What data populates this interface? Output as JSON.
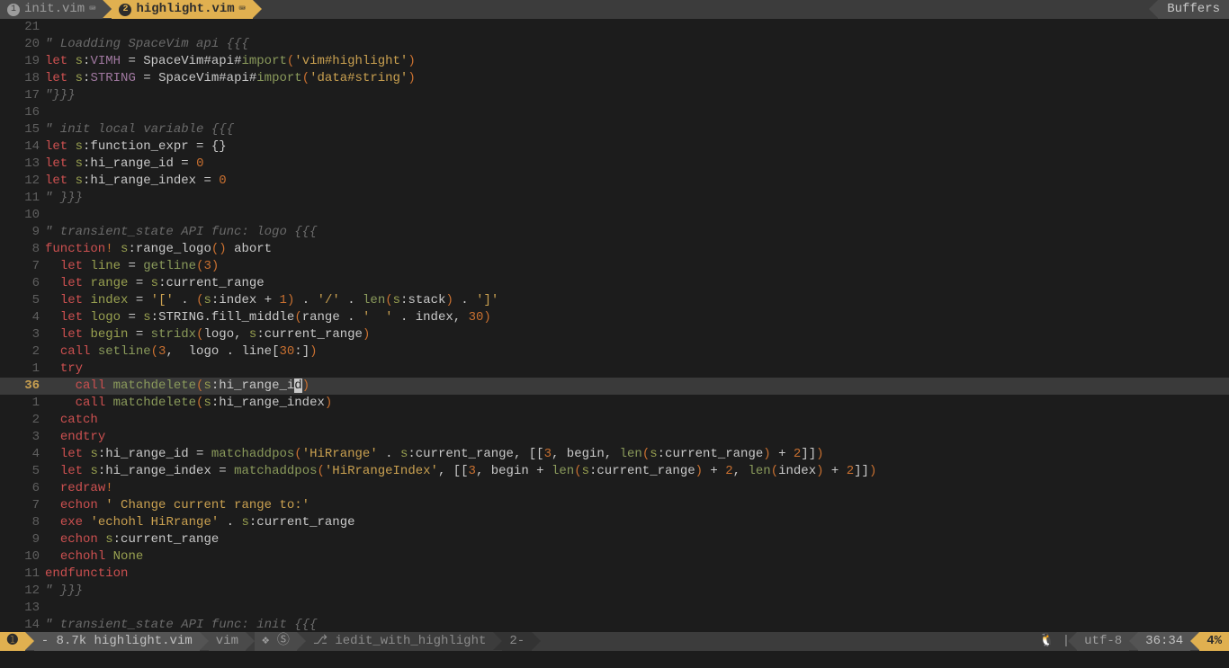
{
  "tabs": {
    "inactive": {
      "num": "1",
      "name": "init.vim"
    },
    "active": {
      "num": "2",
      "name": "highlight.vim"
    },
    "right_label": "Buffers"
  },
  "lines": [
    {
      "n": "21",
      "seg": []
    },
    {
      "n": "20",
      "seg": [
        [
          "\" Loadding SpaceVim api {{{",
          "k-comment"
        ]
      ]
    },
    {
      "n": "19",
      "seg": [
        [
          "let",
          "k-red"
        ],
        [
          " s",
          "k-olive"
        ],
        [
          ":",
          ""
        ],
        [
          "VIMH",
          "k-purple"
        ],
        [
          " = SpaceVim#api#",
          ""
        ],
        [
          "import",
          "k-green"
        ],
        [
          "(",
          "k-orange"
        ],
        [
          "'vim#highlight'",
          "k-yellow"
        ],
        [
          ")",
          "k-orange"
        ]
      ]
    },
    {
      "n": "18",
      "seg": [
        [
          "let",
          "k-red"
        ],
        [
          " s",
          "k-olive"
        ],
        [
          ":",
          ""
        ],
        [
          "STRING",
          "k-purple"
        ],
        [
          " = SpaceVim#api#",
          ""
        ],
        [
          "import",
          "k-green"
        ],
        [
          "(",
          "k-orange"
        ],
        [
          "'data#string'",
          "k-yellow"
        ],
        [
          ")",
          "k-orange"
        ]
      ]
    },
    {
      "n": "17",
      "seg": [
        [
          "\"}}}",
          "k-comment"
        ]
      ]
    },
    {
      "n": "16",
      "seg": []
    },
    {
      "n": "15",
      "seg": [
        [
          "\" init local variable {{{",
          "k-comment"
        ]
      ]
    },
    {
      "n": "14",
      "seg": [
        [
          "let",
          "k-red"
        ],
        [
          " s",
          "k-olive"
        ],
        [
          ":function_expr = {}",
          ""
        ]
      ]
    },
    {
      "n": "13",
      "seg": [
        [
          "let",
          "k-red"
        ],
        [
          " s",
          "k-olive"
        ],
        [
          ":hi_range_id = ",
          ""
        ],
        [
          "0",
          "k-orange"
        ]
      ]
    },
    {
      "n": "12",
      "seg": [
        [
          "let",
          "k-red"
        ],
        [
          " s",
          "k-olive"
        ],
        [
          ":hi_range_index = ",
          ""
        ],
        [
          "0",
          "k-orange"
        ]
      ]
    },
    {
      "n": "11",
      "seg": [
        [
          "\" }}}",
          "k-comment"
        ]
      ]
    },
    {
      "n": "10",
      "seg": []
    },
    {
      "n": "9",
      "seg": [
        [
          "\" transient_state API func: logo {{{",
          "k-comment"
        ]
      ]
    },
    {
      "n": "8",
      "seg": [
        [
          "function",
          "k-red"
        ],
        [
          "!",
          "k-orange"
        ],
        [
          " ",
          ""
        ],
        [
          "s",
          "k-olive"
        ],
        [
          ":range_logo",
          ""
        ],
        [
          "()",
          "k-orange"
        ],
        [
          " abort",
          ""
        ]
      ]
    },
    {
      "n": "7",
      "seg": [
        [
          "  ",
          ""
        ],
        [
          "let",
          "k-red"
        ],
        [
          " ",
          ""
        ],
        [
          "line",
          "k-olive"
        ],
        [
          " = ",
          ""
        ],
        [
          "getline",
          "k-green"
        ],
        [
          "(",
          "k-orange"
        ],
        [
          "3",
          "k-orange"
        ],
        [
          ")",
          "k-orange"
        ]
      ]
    },
    {
      "n": "6",
      "seg": [
        [
          "  ",
          ""
        ],
        [
          "let",
          "k-red"
        ],
        [
          " ",
          ""
        ],
        [
          "range",
          "k-olive"
        ],
        [
          " = ",
          ""
        ],
        [
          "s",
          "k-olive"
        ],
        [
          ":current_range",
          ""
        ]
      ]
    },
    {
      "n": "5",
      "seg": [
        [
          "  ",
          ""
        ],
        [
          "let",
          "k-red"
        ],
        [
          " ",
          ""
        ],
        [
          "index",
          "k-olive"
        ],
        [
          " = ",
          ""
        ],
        [
          "'['",
          "k-yellow"
        ],
        [
          " . ",
          ""
        ],
        [
          "(",
          "k-orange"
        ],
        [
          "s",
          "k-olive"
        ],
        [
          ":index + ",
          ""
        ],
        [
          "1",
          "k-orange"
        ],
        [
          ")",
          "k-orange"
        ],
        [
          " . ",
          ""
        ],
        [
          "'/'",
          "k-yellow"
        ],
        [
          " . ",
          ""
        ],
        [
          "len",
          "k-green"
        ],
        [
          "(",
          "k-orange"
        ],
        [
          "s",
          "k-olive"
        ],
        [
          ":stack",
          ""
        ],
        [
          ")",
          "k-orange"
        ],
        [
          " . ",
          ""
        ],
        [
          "']'",
          "k-yellow"
        ]
      ]
    },
    {
      "n": "4",
      "seg": [
        [
          "  ",
          ""
        ],
        [
          "let",
          "k-red"
        ],
        [
          " ",
          ""
        ],
        [
          "logo",
          "k-olive"
        ],
        [
          " = ",
          ""
        ],
        [
          "s",
          "k-olive"
        ],
        [
          ":STRING.fill_middle",
          ""
        ],
        [
          "(",
          "k-orange"
        ],
        [
          "range . ",
          ""
        ],
        [
          "'  '",
          "k-yellow"
        ],
        [
          " . index, ",
          ""
        ],
        [
          "30",
          "k-orange"
        ],
        [
          ")",
          "k-orange"
        ]
      ]
    },
    {
      "n": "3",
      "seg": [
        [
          "  ",
          ""
        ],
        [
          "let",
          "k-red"
        ],
        [
          " ",
          ""
        ],
        [
          "begin",
          "k-olive"
        ],
        [
          " = ",
          ""
        ],
        [
          "stridx",
          "k-green"
        ],
        [
          "(",
          "k-orange"
        ],
        [
          "logo, ",
          ""
        ],
        [
          "s",
          "k-olive"
        ],
        [
          ":current_range",
          ""
        ],
        [
          ")",
          "k-orange"
        ]
      ]
    },
    {
      "n": "2",
      "seg": [
        [
          "  ",
          ""
        ],
        [
          "call",
          "k-red"
        ],
        [
          " ",
          ""
        ],
        [
          "setline",
          "k-green"
        ],
        [
          "(",
          "k-orange"
        ],
        [
          "3",
          "k-orange"
        ],
        [
          ",  logo . line[",
          ""
        ],
        [
          "30",
          "k-orange"
        ],
        [
          ":]",
          ""
        ],
        [
          ")",
          "k-orange"
        ]
      ]
    },
    {
      "n": "1",
      "seg": [
        [
          "  ",
          ""
        ],
        [
          "try",
          "k-red"
        ]
      ]
    },
    {
      "n": "36",
      "cur": true,
      "seg": [
        [
          "    ",
          ""
        ],
        [
          "call",
          "k-red"
        ],
        [
          " ",
          ""
        ],
        [
          "matchdelete",
          "k-green"
        ],
        [
          "(",
          "k-orange"
        ],
        [
          "s",
          "k-olive"
        ],
        [
          ":hi_range_i",
          ""
        ],
        [
          "d",
          "cursor"
        ],
        [
          ")",
          "k-orange"
        ]
      ]
    },
    {
      "n": "1",
      "seg": [
        [
          "    ",
          ""
        ],
        [
          "call",
          "k-red"
        ],
        [
          " ",
          ""
        ],
        [
          "matchdelete",
          "k-green"
        ],
        [
          "(",
          "k-orange"
        ],
        [
          "s",
          "k-olive"
        ],
        [
          ":hi_range_index",
          ""
        ],
        [
          ")",
          "k-orange"
        ]
      ]
    },
    {
      "n": "2",
      "seg": [
        [
          "  ",
          ""
        ],
        [
          "catch",
          "k-red"
        ]
      ]
    },
    {
      "n": "3",
      "seg": [
        [
          "  ",
          ""
        ],
        [
          "endtry",
          "k-red"
        ]
      ]
    },
    {
      "n": "4",
      "seg": [
        [
          "  ",
          ""
        ],
        [
          "let",
          "k-red"
        ],
        [
          " ",
          ""
        ],
        [
          "s",
          "k-olive"
        ],
        [
          ":hi_range_id = ",
          ""
        ],
        [
          "matchaddpos",
          "k-green"
        ],
        [
          "(",
          "k-orange"
        ],
        [
          "'HiRrange'",
          "k-yellow"
        ],
        [
          " . ",
          ""
        ],
        [
          "s",
          "k-olive"
        ],
        [
          ":current_range, [[",
          ""
        ],
        [
          "3",
          "k-orange"
        ],
        [
          ", begin, ",
          ""
        ],
        [
          "len",
          "k-green"
        ],
        [
          "(",
          "k-orange"
        ],
        [
          "s",
          "k-olive"
        ],
        [
          ":current_range",
          ""
        ],
        [
          ")",
          "k-orange"
        ],
        [
          " + ",
          ""
        ],
        [
          "2",
          "k-orange"
        ],
        [
          "]]",
          ""
        ],
        [
          ")",
          "k-orange"
        ]
      ]
    },
    {
      "n": "5",
      "seg": [
        [
          "  ",
          ""
        ],
        [
          "let",
          "k-red"
        ],
        [
          " ",
          ""
        ],
        [
          "s",
          "k-olive"
        ],
        [
          ":hi_range_index = ",
          ""
        ],
        [
          "matchaddpos",
          "k-green"
        ],
        [
          "(",
          "k-orange"
        ],
        [
          "'HiRrangeIndex'",
          "k-yellow"
        ],
        [
          ", [[",
          ""
        ],
        [
          "3",
          "k-orange"
        ],
        [
          ", begin + ",
          ""
        ],
        [
          "len",
          "k-green"
        ],
        [
          "(",
          "k-orange"
        ],
        [
          "s",
          "k-olive"
        ],
        [
          ":current_range",
          ""
        ],
        [
          ")",
          "k-orange"
        ],
        [
          " + ",
          ""
        ],
        [
          "2",
          "k-orange"
        ],
        [
          ", ",
          ""
        ],
        [
          "len",
          "k-green"
        ],
        [
          "(",
          "k-orange"
        ],
        [
          "index",
          ""
        ],
        [
          ")",
          "k-orange"
        ],
        [
          " + ",
          ""
        ],
        [
          "2",
          "k-orange"
        ],
        [
          "]]",
          ""
        ],
        [
          ")",
          "k-orange"
        ]
      ]
    },
    {
      "n": "6",
      "seg": [
        [
          "  ",
          ""
        ],
        [
          "redraw",
          "k-red"
        ],
        [
          "!",
          "k-orange"
        ]
      ]
    },
    {
      "n": "7",
      "seg": [
        [
          "  ",
          ""
        ],
        [
          "echon",
          "k-red"
        ],
        [
          " ",
          ""
        ],
        [
          "' Change current range to:'",
          "k-yellow"
        ]
      ]
    },
    {
      "n": "8",
      "seg": [
        [
          "  ",
          ""
        ],
        [
          "exe",
          "k-red"
        ],
        [
          " ",
          ""
        ],
        [
          "'echohl HiRrange'",
          "k-yellow"
        ],
        [
          " . ",
          ""
        ],
        [
          "s",
          "k-olive"
        ],
        [
          ":current_range",
          ""
        ]
      ]
    },
    {
      "n": "9",
      "seg": [
        [
          "  ",
          ""
        ],
        [
          "echon",
          "k-red"
        ],
        [
          " ",
          ""
        ],
        [
          "s",
          "k-olive"
        ],
        [
          ":current_range",
          ""
        ]
      ]
    },
    {
      "n": "10",
      "seg": [
        [
          "  ",
          ""
        ],
        [
          "echohl",
          "k-red"
        ],
        [
          " ",
          ""
        ],
        [
          "None",
          "k-olive"
        ]
      ]
    },
    {
      "n": "11",
      "seg": [
        [
          "endfunction",
          "k-red"
        ]
      ]
    },
    {
      "n": "12",
      "seg": [
        [
          "\" }}}",
          "k-comment"
        ]
      ]
    },
    {
      "n": "13",
      "seg": []
    },
    {
      "n": "14",
      "seg": [
        [
          "\" transient_state API func: init {{{",
          "k-comment"
        ]
      ]
    }
  ],
  "status": {
    "mode_icon": "➊",
    "file": "- 8.7k highlight.vim",
    "filetype": "vim",
    "git_sym": "❖ Ⓢ",
    "branch": "⎇ iedit_with_highlight",
    "layer": "2-",
    "os": "🐧 |",
    "encoding": "utf-8",
    "position": "36:34",
    "percent": "4%"
  }
}
